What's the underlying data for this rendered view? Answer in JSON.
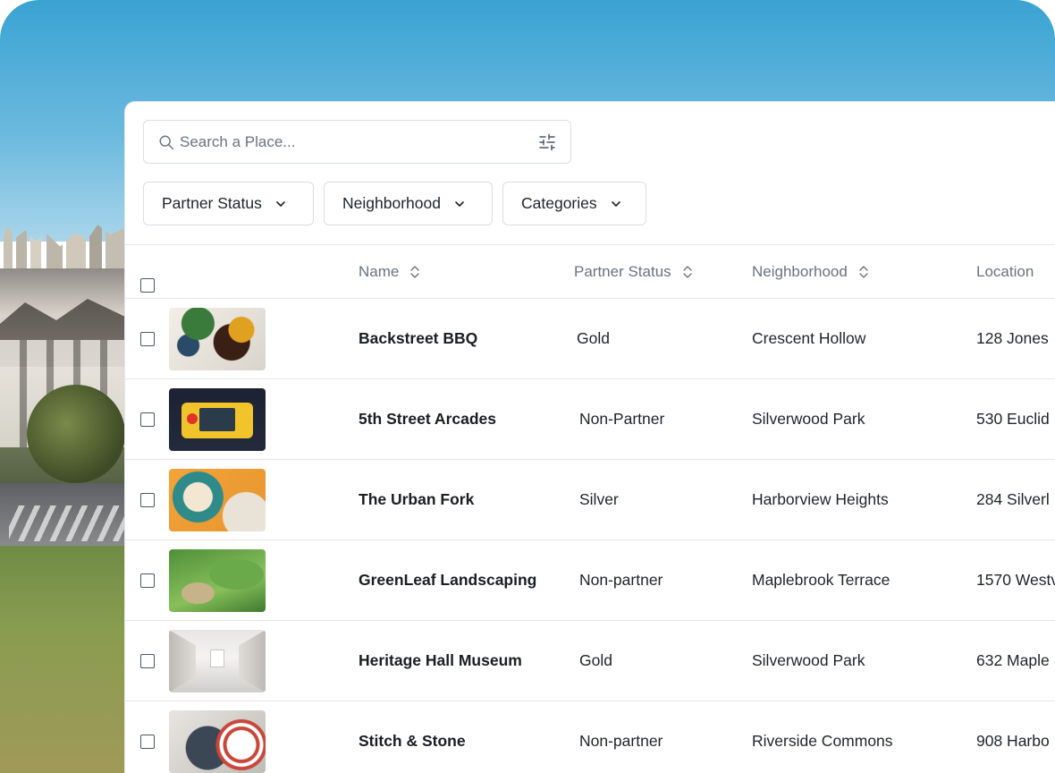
{
  "search": {
    "placeholder": "Search a Place..."
  },
  "filters": [
    {
      "label": "Partner Status"
    },
    {
      "label": "Neighborhood"
    },
    {
      "label": "Categories"
    }
  ],
  "table": {
    "columns": {
      "name": "Name",
      "partner_status": "Partner Status",
      "neighborhood": "Neighborhood",
      "location": "Location"
    },
    "rows": [
      {
        "name": "Backstreet BBQ",
        "partner_status": "Gold",
        "neighborhood": "Crescent Hollow",
        "location": "128 Jones"
      },
      {
        "name": "5th Street Arcades",
        "partner_status": "Non-Partner",
        "neighborhood": "Silverwood Park",
        "location": "530 Euclid"
      },
      {
        "name": "The Urban Fork",
        "partner_status": "Silver",
        "neighborhood": "Harborview Heights",
        "location": "284 Silverl"
      },
      {
        "name": "GreenLeaf Landscaping",
        "partner_status": "Non-partner",
        "neighborhood": "Maplebrook Terrace",
        "location": "1570 Westv"
      },
      {
        "name": "Heritage Hall Museum",
        "partner_status": "Gold",
        "neighborhood": "Silverwood Park",
        "location": "632 Maple"
      },
      {
        "name": "Stitch & Stone",
        "partner_status": "Non-partner",
        "neighborhood": "Riverside Commons",
        "location": "908 Harbo"
      }
    ]
  },
  "icons": {
    "search": "search-icon",
    "filter": "sliders-icon",
    "dropdown": "chevron-down-icon",
    "sort": "sort-icon"
  }
}
